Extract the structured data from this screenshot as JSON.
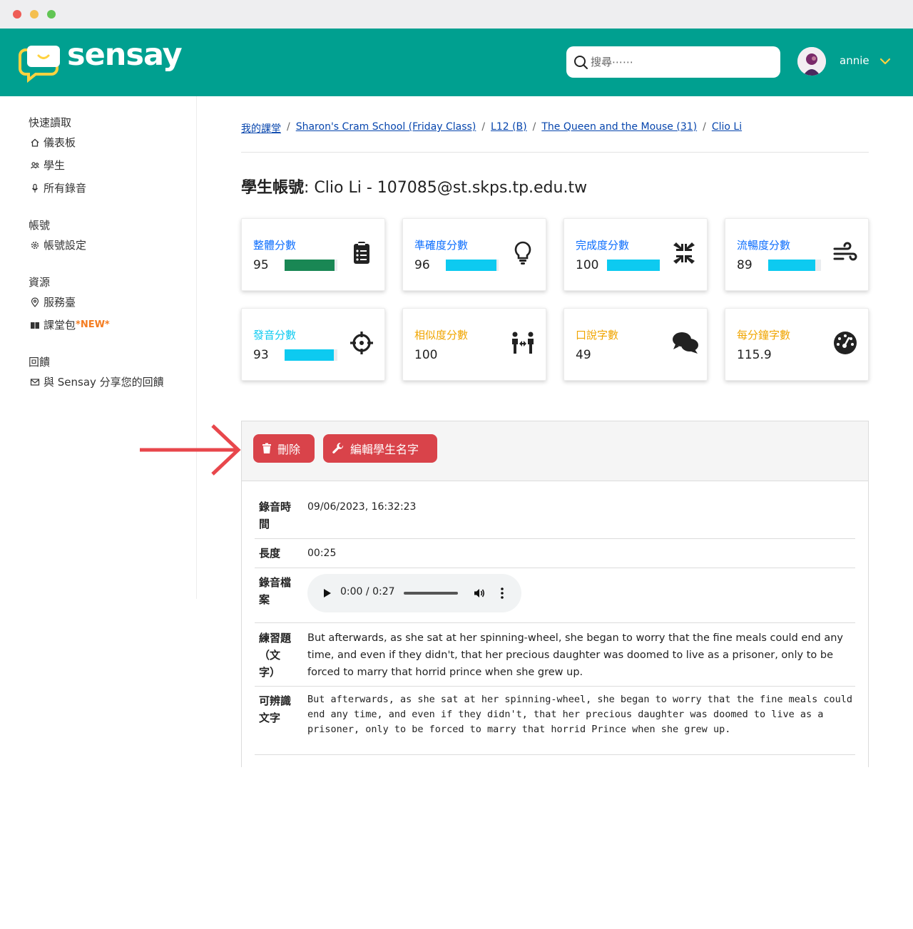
{
  "brand": {
    "name": "sensay"
  },
  "search": {
    "placeholder": "搜尋⋯⋯"
  },
  "user": {
    "name": "annie"
  },
  "sidebar": {
    "sections": [
      {
        "title": "快速讀取",
        "items": [
          {
            "label": "儀表板",
            "icon": "home-icon"
          },
          {
            "label": "學生",
            "icon": "users-icon"
          },
          {
            "label": "所有錄音",
            "icon": "microphone-icon"
          }
        ]
      },
      {
        "title": "帳號",
        "items": [
          {
            "label": "帳號設定",
            "icon": "gear-icon"
          }
        ]
      },
      {
        "title": "資源",
        "items": [
          {
            "label": "服務臺",
            "icon": "location-pin-icon"
          },
          {
            "label": "課堂包",
            "badge": "*NEW*",
            "icon": "book-icon"
          }
        ]
      },
      {
        "title": "回饋",
        "items": [
          {
            "label": "與 Sensay 分享您的回饋",
            "icon": "mail-icon"
          }
        ]
      }
    ]
  },
  "breadcrumb": [
    "我的課堂",
    "Sharon's Cram School (Friday Class)",
    "L12 (B)",
    "The Queen and the Mouse (31)",
    "Clio Li"
  ],
  "page_title": {
    "label": "學生帳號",
    "value": ": Clio Li - 107085@st.skps.tp.edu.tw"
  },
  "cards": [
    {
      "label": "整體分數",
      "value": "95",
      "bar_fraction": 0.95,
      "color": "#0d6efd",
      "bar_color": "#198754",
      "icon": "clipboard-list-icon"
    },
    {
      "label": "準確度分數",
      "value": "96",
      "bar_fraction": 0.96,
      "color": "#0d6efd",
      "bar_color": "#0dcaf0",
      "icon": "lightbulb-icon"
    },
    {
      "label": "完成度分數",
      "value": "100",
      "bar_fraction": 1.0,
      "color": "#0d6efd",
      "bar_color": "#0dcaf0",
      "icon": "compress-arrows-icon"
    },
    {
      "label": "流暢度分數",
      "value": "89",
      "bar_fraction": 0.89,
      "color": "#0d6efd",
      "bar_color": "#0dcaf0",
      "icon": "wind-icon"
    },
    {
      "label": "發音分數",
      "value": "93",
      "bar_fraction": 0.93,
      "color": "#0dcaf0",
      "bar_color": "#0dcaf0",
      "icon": "crosshairs-icon"
    },
    {
      "label": "相似度分數",
      "value": "100",
      "color": "#f0a500",
      "icon": "people-arrows-icon"
    },
    {
      "label": "口說字數",
      "value": "49",
      "color": "#f0a500",
      "icon": "comments-icon"
    },
    {
      "label": "每分鐘字數",
      "value": "115.9",
      "color": "#f0a500",
      "icon": "gauge-icon"
    }
  ],
  "actions": {
    "delete_label": "刪除",
    "edit_label": "編輯學生名字"
  },
  "details": {
    "recorded_time_label": "錄音時間",
    "recorded_time": "09/06/2023, 16:32:23",
    "length_label": "長度",
    "length": "00:25",
    "audio_label": "錄音檔案",
    "audio_current": "0:00",
    "audio_total": "0:27",
    "exercise_label": "練習題（文字）",
    "exercise_text": "But afterwards, as she sat at her spinning-wheel, she began to worry that the fine meals could end any time, and even if they didn't, that her precious daughter was doomed to live as a prisoner, only to be forced to marry that horrid prince when she grew up.",
    "recognized_label": "可辨識文字",
    "recognized_text": "But afterwards, as she sat at her spinning-wheel, she began to worry that the fine meals could end any time, and even if they didn't, that her precious daughter was doomed to live as a prisoner, only to be forced to marry that horrid Prince when she grew up."
  },
  "colors": {
    "header": "#00a090",
    "danger": "#d9434a",
    "annotation_arrow": "#e8474c"
  }
}
